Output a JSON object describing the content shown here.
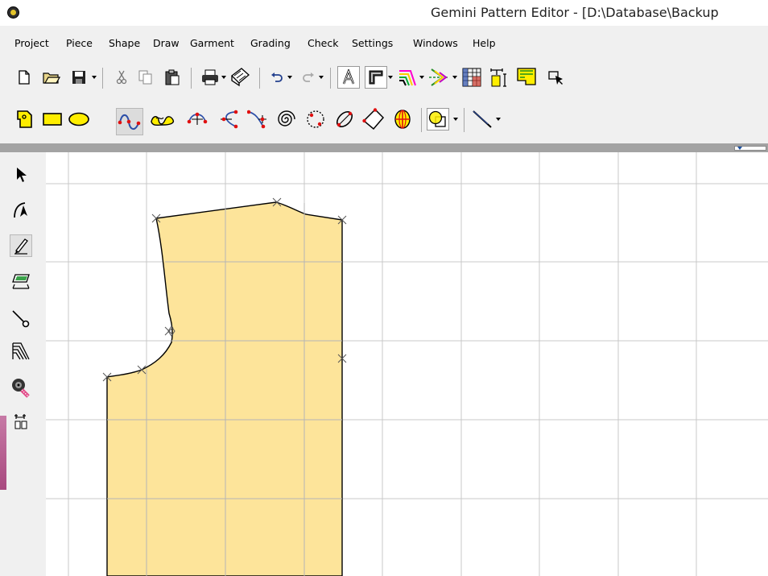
{
  "window": {
    "title": "Gemini Pattern Editor - [D:\\Database\\Backup"
  },
  "menu": {
    "items": [
      "Project",
      "Piece",
      "Shape",
      "Draw",
      "Garment",
      "Grading",
      "Check",
      "Settings",
      "Windows",
      "Help"
    ]
  },
  "toolbar_main": {
    "buttons": [
      "new-icon",
      "open-folder-icon",
      "save-icon",
      "cut-icon",
      "copy-icon",
      "paste-icon",
      "print-icon",
      "plot-icon",
      "undo-icon",
      "redo-icon",
      "text-style-icon",
      "corner-icon",
      "grade-lines-icon",
      "fold-icon",
      "spreadsheet-icon",
      "measure-icon",
      "piece-icon",
      "select-arrow-icon"
    ]
  },
  "toolbar_shapes": {
    "buttons": [
      "piece-shape-icon",
      "rectangle-icon",
      "ellipse-icon",
      "curve-icon",
      "freehand-icon",
      "point-curve-icon",
      "arc-icon",
      "bezier-icon",
      "spiral-icon",
      "dotted-circle-icon",
      "oval-icon",
      "diamond-icon",
      "sphere-icon",
      "shape-combine-icon",
      "line-tool-icon"
    ]
  },
  "side_tools": {
    "items": [
      "select-arrow-icon",
      "bend-arrow-icon",
      "pencil-icon",
      "piece-transform-icon",
      "pin-icon",
      "grading-icon",
      "tape-measure-icon",
      "dimension-icon"
    ]
  },
  "colors": {
    "piece_fill": "#fde49a",
    "grid": "#c8c8c8",
    "canvas": "#ffffff",
    "accent_yellow": "#ffee00"
  }
}
